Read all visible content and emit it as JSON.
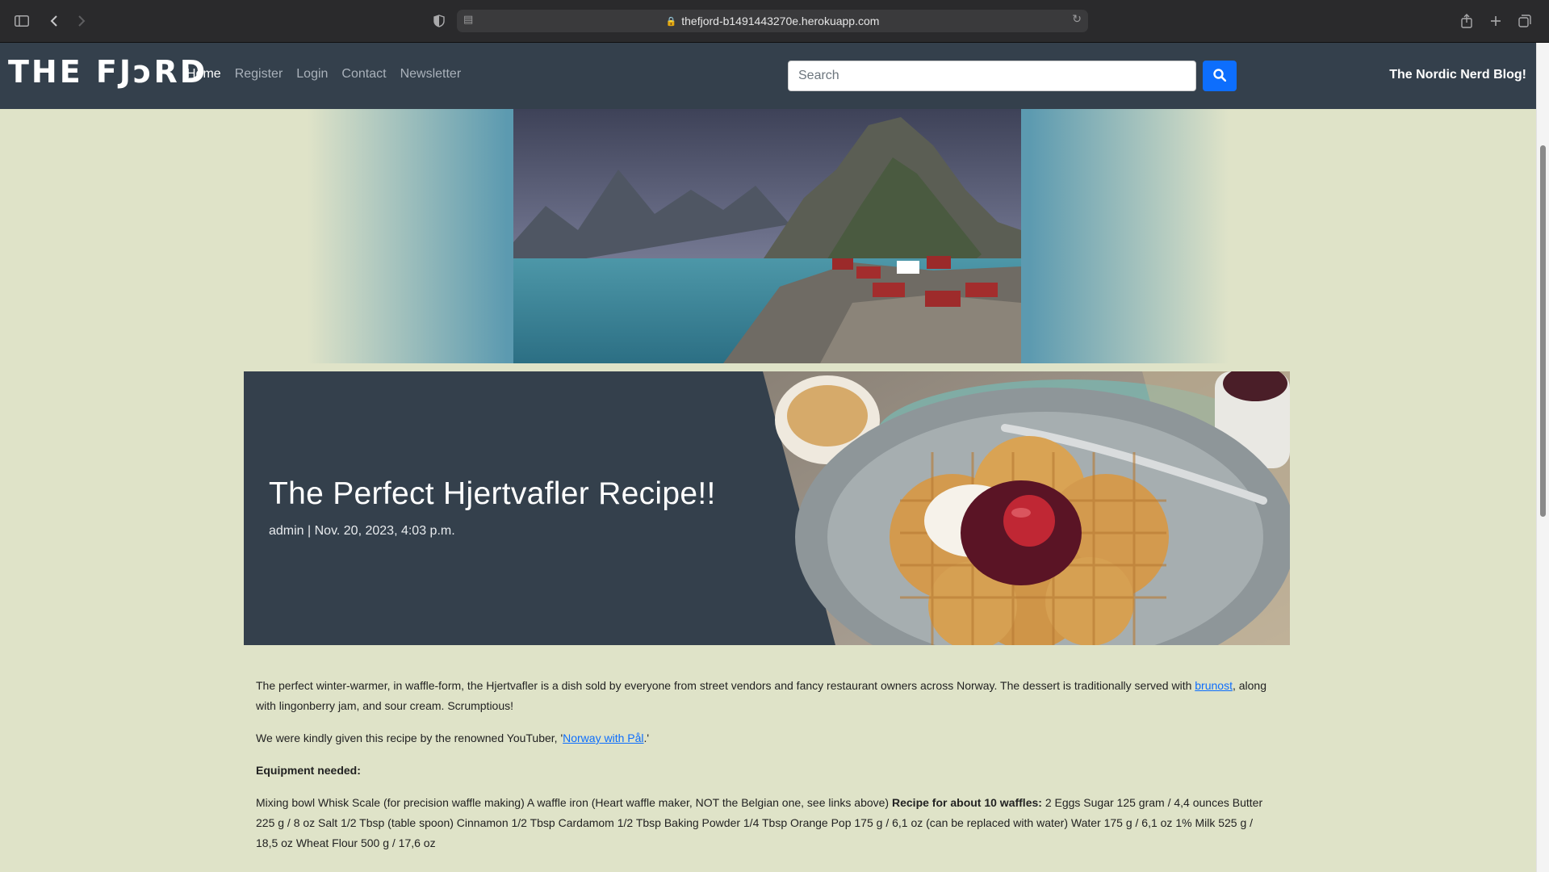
{
  "browser": {
    "url": "thefjord-b1491443270e.herokuapp.com",
    "icons": [
      "sidebar-icon",
      "back-icon",
      "forward-icon",
      "shield-icon",
      "reader-icon",
      "lock-icon",
      "reload-icon",
      "share-icon",
      "new-tab-icon",
      "tabs-overview-icon"
    ]
  },
  "nav": {
    "logo": "THE FJɔRD",
    "links": [
      "Home",
      "Register",
      "Login",
      "Contact",
      "Newsletter"
    ],
    "active": "Home",
    "search_placeholder": "Search",
    "search_button_icon": "search-icon",
    "tagline": "The Nordic Nerd Blog!"
  },
  "colors": {
    "navbar": "#34404c",
    "page_background": "#dfe3c8",
    "accent_button": "#0d6efd",
    "link": "#0d6efd"
  },
  "post": {
    "title": "The Perfect Hjertvafler Recipe!!",
    "meta": "admin | Nov. 20, 2023, 4:03 p.m.",
    "p1_text": "The perfect winter-warmer, in waffle-form, the Hjertvafler is a dish sold by everyone from street vendors and fancy restaurant owners across Norway. The dessert is traditionally served with ",
    "p1_link": "brunost",
    "p1_tail": ", along with lingonberry jam, and sour cream. Scrumptious!",
    "p2_text": "We were kindly given this recipe by the renowned YouTuber, '",
    "p2_link": "Norway with Pål",
    "p2_tail": ".'",
    "equipment_heading": "Equipment needed:",
    "p4_text": "Mixing bowl Whisk Scale (for precision waffle making) A waffle iron (Heart waffle maker, NOT the Belgian one, see links above) ",
    "p4_bold": "Recipe for about 10 waffles:",
    "p4_tail": " 2 Eggs Sugar 125 gram / 4,4 ounces Butter 225 g / 8 oz Salt 1/2 Tbsp (table spoon) Cinnamon 1/2 Tbsp Cardamom 1/2 Tbsp Baking Powder 1/4 Tbsp Orange Pop 175 g / 6,1 oz (can be replaced with water) Water 175 g / 6,1 oz 1% Milk 525 g / 18,5 oz Wheat Flour 500 g / 17,6 oz"
  }
}
